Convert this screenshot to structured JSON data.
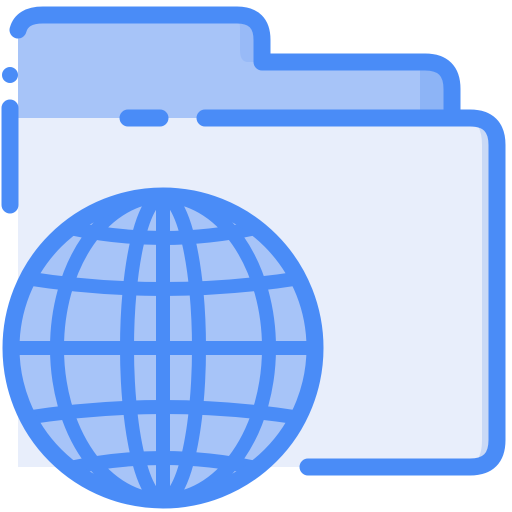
{
  "icon": {
    "name": "network-folder-icon",
    "depicts": [
      "folder-icon",
      "globe-icon"
    ]
  },
  "colors": {
    "outline": "#4a8cf7",
    "folder_back": "#a7c4f8",
    "folder_front": "#e8eefb",
    "folder_side_shade": "#c9d9f6",
    "globe_fill": "#a7c4f8",
    "globe_shade": "#8db4f6"
  }
}
